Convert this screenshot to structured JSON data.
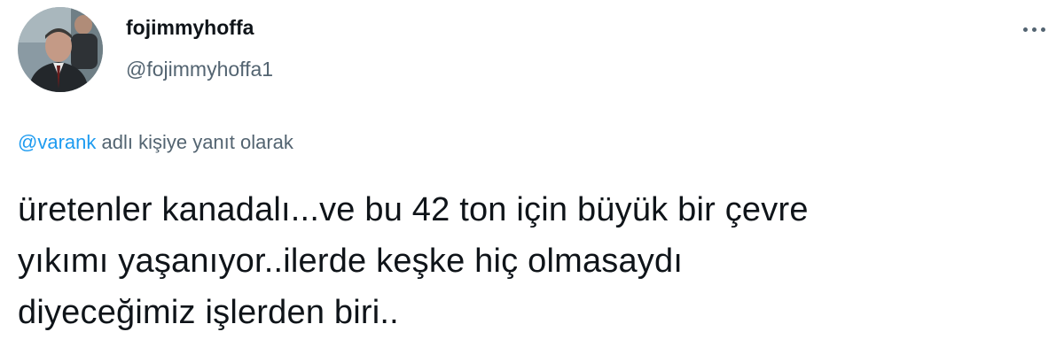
{
  "author": {
    "display_name": "fojimmyhoffa",
    "handle": "@fojimmyhoffa1"
  },
  "more_menu": {
    "icon": "more-horizontal-icon"
  },
  "reply_context": {
    "mention": "@varank",
    "suffix": " adlı kişiye yanıt olarak"
  },
  "tweet": {
    "lines": [
      "üretenler kanadalı...ve bu 42 ton için büyük bir çevre",
      "yıkımı yaşanıyor..ilerde keşke hiç olmasaydı",
      "diyeceğimiz işlerden biri.."
    ]
  },
  "colors": {
    "text_primary": "#0f1419",
    "text_secondary": "#536471",
    "link": "#1d9bf0",
    "background": "#ffffff"
  }
}
